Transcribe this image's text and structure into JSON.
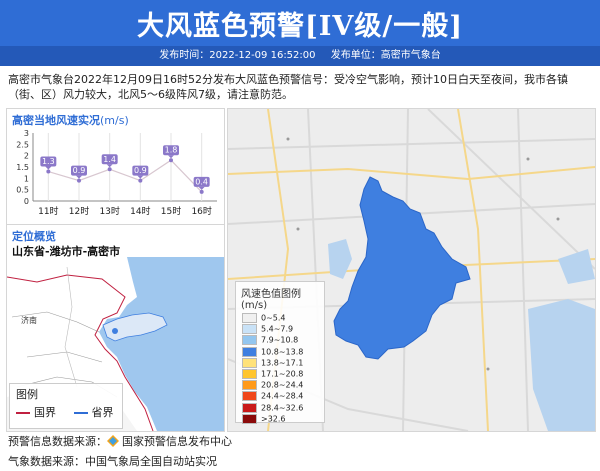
{
  "header": {
    "title": "大风蓝色预警[IV级/一般]",
    "publish_time_label": "发布时间：2022-12-09 16:52:00",
    "publisher_label": "发布单位：高密市气象台"
  },
  "description": "高密市气象台2022年12月09日16时52分发布大风蓝色预警信号：受冷空气影响，预计10日白天至夜间，我市各镇（街、区）风力较大，北风5～6级阵风7级，请注意防范。",
  "wind_panel": {
    "title": "高密当地风速实况",
    "unit": "(m/s)"
  },
  "chart_data": {
    "type": "line",
    "categories": [
      "11时",
      "12时",
      "13时",
      "14时",
      "15时",
      "16时"
    ],
    "values": [
      1.3,
      0.9,
      1.4,
      0.9,
      1.8,
      0.4
    ],
    "ylim": [
      0,
      3
    ],
    "yticks": [
      "0",
      "0.5",
      "1",
      "1.5",
      "2",
      "2.5",
      "3"
    ],
    "grid": "vertical"
  },
  "location_panel": {
    "title": "定位概览",
    "subtitle": "山东省-潍坊市-高密市",
    "legend_title": "图例",
    "legend_items": [
      "国界",
      "省界"
    ],
    "city_label": "济南"
  },
  "map_legend": {
    "title": "风速色值图例 (m/s)",
    "items": [
      {
        "label": "0~5.4",
        "color": "#f0f0f0"
      },
      {
        "label": "5.4~7.9",
        "color": "#c9e2f7"
      },
      {
        "label": "7.9~10.8",
        "color": "#93c6ef"
      },
      {
        "label": "10.8~13.8",
        "color": "#3f7fe0"
      },
      {
        "label": "13.8~17.1",
        "color": "#ffe27a"
      },
      {
        "label": "17.1~20.8",
        "color": "#ffc52e"
      },
      {
        "label": "20.8~24.4",
        "color": "#ff9a1a"
      },
      {
        "label": "24.4~28.4",
        "color": "#f0471a"
      },
      {
        "label": "28.4~32.6",
        "color": "#c91a1a"
      },
      {
        "label": ">32.6",
        "color": "#8a0a0a"
      }
    ]
  },
  "footer": {
    "warning_source": "预警信息数据来源：",
    "warning_source_name": "国家预警信息发布中心",
    "weather_source": "气象数据来源：中国气象局全国自动站实况"
  },
  "colors": {
    "header_blue": "#2f6dd5",
    "meta_bar": "#2459b8",
    "region_fill": "#3f7fe0",
    "point_fill": "#8b78c9"
  }
}
